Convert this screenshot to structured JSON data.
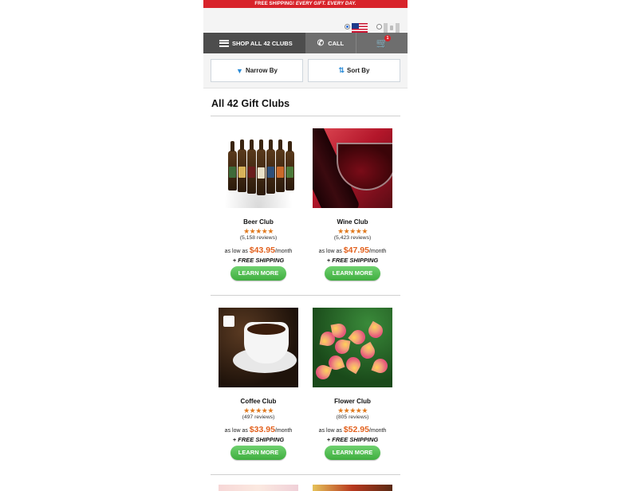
{
  "promo": {
    "bold": "FREE SHIPPING!",
    "rest": " EVERY GIFT. EVERY DAY."
  },
  "country": {
    "options": [
      "us-flag-icon",
      "canada-flag-icon"
    ],
    "selected": "us"
  },
  "nav": {
    "shop_label": "SHOP ALL 42 CLUBS",
    "call_label": "CALL",
    "cart_count": "1"
  },
  "filters": {
    "narrow_label": "Narrow By",
    "sort_label": "Sort By"
  },
  "page_title": "All 42 Gift Clubs",
  "common": {
    "stars": "★★★★★",
    "price_prefix": "as low as ",
    "price_suffix": "/month",
    "shipping": "+ FREE SHIPPING",
    "learn_more": "LEARN MORE"
  },
  "products": [
    {
      "name": "Beer Club",
      "rating": 4.5,
      "reviews": "(5,158 reviews)",
      "price": "$43.95"
    },
    {
      "name": "Wine Club",
      "rating": 4.5,
      "reviews": "(5,423 reviews)",
      "price": "$47.95"
    },
    {
      "name": "Coffee Club",
      "rating": 4.5,
      "reviews": "(497 reviews)",
      "price": "$33.95"
    },
    {
      "name": "Flower Club",
      "rating": 4.5,
      "reviews": "(805 reviews)",
      "price": "$52.95"
    }
  ],
  "colors": {
    "accent_red": "#d8232a",
    "price_orange": "#e2611e",
    "button_green": "#4cbf4c",
    "nav_gray": "#4d4d4d"
  }
}
